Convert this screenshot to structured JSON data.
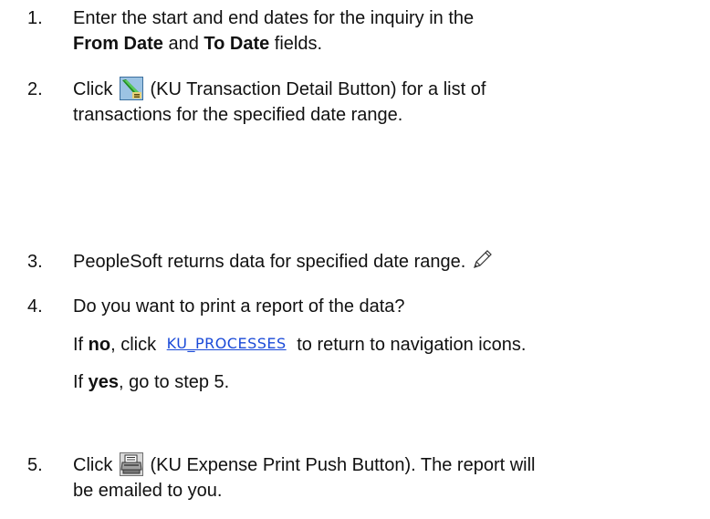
{
  "steps": [
    {
      "number": "1.",
      "line1": "Enter the start and end dates for the inquiry in the",
      "line2_bold1": "From Date",
      "line2_mid": " and ",
      "line2_bold2": "To Date",
      "line2_end": " fields."
    },
    {
      "number": "2.",
      "pre": "Click ",
      "icon": "ku-transaction-detail-button-icon",
      "post": " (KU Transaction Detail Button) for a list of",
      "line2": "transactions for the specified date range."
    },
    {
      "number": "3.",
      "text": "PeopleSoft returns data for specified date range.",
      "icon": "pencil-icon"
    },
    {
      "number": "4.",
      "question": "Do you want to print a report of the data?",
      "no_pre": "If ",
      "no_bold": "no",
      "no_mid": ", click ",
      "no_link": "KU_PROCESSES",
      "no_post": " to return to navigation icons.",
      "yes_pre": "If ",
      "yes_bold": "yes",
      "yes_post": ", go to step 5."
    },
    {
      "number": "5.",
      "pre": "Click ",
      "icon": "print-icon",
      "post": " (KU Expense Print Push Button).  The report will",
      "line2": "be emailed to you."
    }
  ],
  "colors": {
    "text": "#111111",
    "link": "#1a4ad8"
  }
}
